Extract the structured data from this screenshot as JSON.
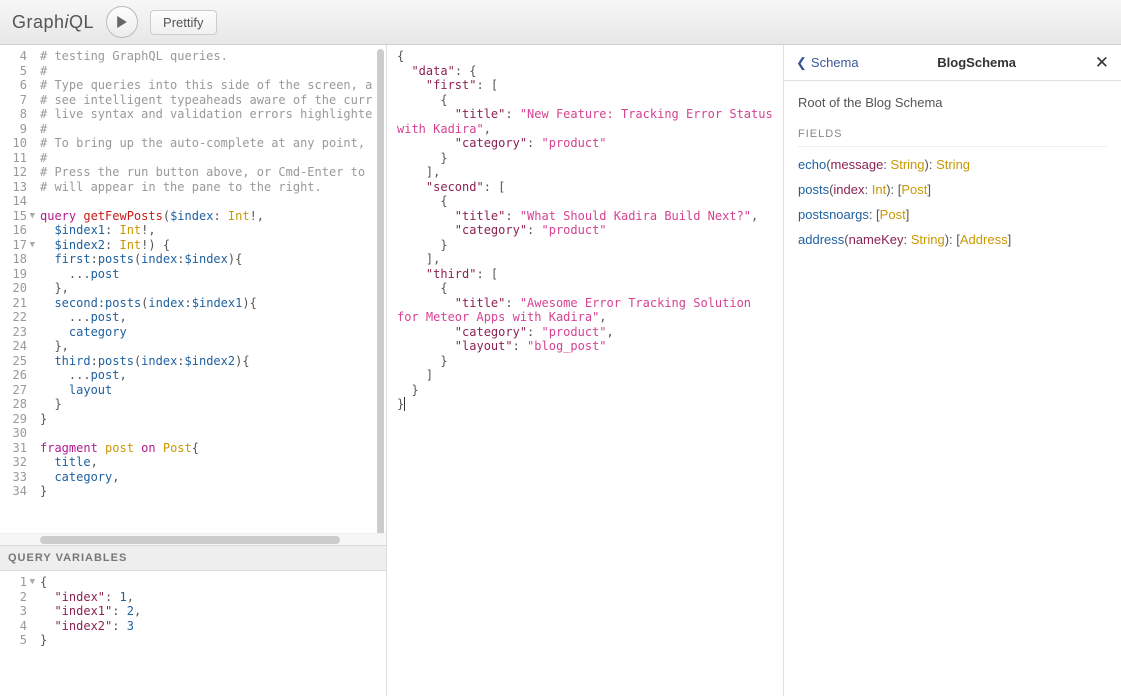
{
  "topbar": {
    "logo_pre": "Graph",
    "logo_i": "i",
    "logo_post": "QL",
    "prettify_label": "Prettify"
  },
  "query_lines": [
    {
      "n": 4,
      "html": "<span class='c-comment'># testing GraphQL queries.</span>"
    },
    {
      "n": 5,
      "html": "<span class='c-comment'>#</span>"
    },
    {
      "n": 6,
      "html": "<span class='c-comment'># Type queries into this side of the screen, a</span>"
    },
    {
      "n": 7,
      "html": "<span class='c-comment'># see intelligent typeaheads aware of the curr</span>"
    },
    {
      "n": 8,
      "html": "<span class='c-comment'># live syntax and validation errors highlighte</span>"
    },
    {
      "n": 9,
      "html": "<span class='c-comment'>#</span>"
    },
    {
      "n": 10,
      "html": "<span class='c-comment'># To bring up the auto-complete at any point,</span>"
    },
    {
      "n": 11,
      "html": "<span class='c-comment'>#</span>"
    },
    {
      "n": 12,
      "html": "<span class='c-comment'># Press the run button above, or Cmd-Enter to</span>"
    },
    {
      "n": 13,
      "html": "<span class='c-comment'># will appear in the pane to the right.</span>"
    },
    {
      "n": 14,
      "html": ""
    },
    {
      "n": 15,
      "fold": true,
      "html": "<span class='c-kw'>query</span> <span class='c-def'>getFewPosts</span>(<span class='c-var'>$index</span>: <span class='c-type'>Int</span>!,"
    },
    {
      "n": 16,
      "html": "  <span class='c-var'>$index1</span>: <span class='c-type'>Int</span>!,"
    },
    {
      "n": 17,
      "fold": true,
      "html": "  <span class='c-var'>$index2</span>: <span class='c-type'>Int</span>!) {"
    },
    {
      "n": 18,
      "html": "  <span class='c-prop'>first</span>:<span class='c-prop'>posts</span>(<span class='c-prop'>index</span>:<span class='c-var'>$index</span>){"
    },
    {
      "n": 19,
      "html": "    ...<span class='c-prop'>post</span>"
    },
    {
      "n": 20,
      "html": "  },"
    },
    {
      "n": 21,
      "html": "  <span class='c-prop'>second</span>:<span class='c-prop'>posts</span>(<span class='c-prop'>index</span>:<span class='c-var'>$index1</span>){"
    },
    {
      "n": 22,
      "html": "    ...<span class='c-prop'>post</span>,"
    },
    {
      "n": 23,
      "html": "    <span class='c-prop'>category</span>"
    },
    {
      "n": 24,
      "html": "  },"
    },
    {
      "n": 25,
      "html": "  <span class='c-prop'>third</span>:<span class='c-prop'>posts</span>(<span class='c-prop'>index</span>:<span class='c-var'>$index2</span>){"
    },
    {
      "n": 26,
      "html": "    ...<span class='c-prop'>post</span>,"
    },
    {
      "n": 27,
      "html": "    <span class='c-prop'>layout</span>"
    },
    {
      "n": 28,
      "html": "  }"
    },
    {
      "n": 29,
      "html": "}"
    },
    {
      "n": 30,
      "html": ""
    },
    {
      "n": 31,
      "html": "<span class='c-kw'>fragment</span> <span class='c-type'>post</span> <span class='c-kw'>on</span> <span class='c-type'>Post</span>{"
    },
    {
      "n": 32,
      "html": "  <span class='c-prop'>title</span>,"
    },
    {
      "n": 33,
      "html": "  <span class='c-prop'>category</span>,"
    },
    {
      "n": 34,
      "html": "}"
    }
  ],
  "vars_header": "QUERY VARIABLES",
  "vars_lines": [
    {
      "n": 1,
      "fold": true,
      "html": "{"
    },
    {
      "n": 2,
      "html": "  <span class='c-key'>\"index\"</span>: <span class='c-num'>1</span>,"
    },
    {
      "n": 3,
      "html": "  <span class='c-key'>\"index1\"</span>: <span class='c-num'>2</span>,"
    },
    {
      "n": 4,
      "html": "  <span class='c-key'>\"index2\"</span>: <span class='c-num'>3</span>"
    },
    {
      "n": 5,
      "html": "}"
    }
  ],
  "result_lines": [
    {
      "fold": true,
      "html": "{"
    },
    {
      "fold": true,
      "html": "  <span class='c-key'>\"data\"</span>: {"
    },
    {
      "fold": true,
      "html": "    <span class='c-key'>\"first\"</span>: ["
    },
    {
      "fold": true,
      "html": "      {"
    },
    {
      "html": "        <span class='c-key'>\"title\"</span>: <span class='c-str'>\"New Feature: Tracking Error Status with Kadira\"</span>,"
    },
    {
      "html": "        <span class='c-key'>\"category\"</span>: <span class='c-str'>\"product\"</span>"
    },
    {
      "html": "      }"
    },
    {
      "html": "    ],"
    },
    {
      "fold": true,
      "html": "    <span class='c-key'>\"second\"</span>: ["
    },
    {
      "fold": true,
      "html": "      {"
    },
    {
      "html": "        <span class='c-key'>\"title\"</span>: <span class='c-str'>\"What Should Kadira Build Next?\"</span>,"
    },
    {
      "html": "        <span class='c-key'>\"category\"</span>: <span class='c-str'>\"product\"</span>"
    },
    {
      "html": "      }"
    },
    {
      "html": "    ],"
    },
    {
      "fold": true,
      "html": "    <span class='c-key'>\"third\"</span>: ["
    },
    {
      "fold": true,
      "html": "      {"
    },
    {
      "html": "        <span class='c-key'>\"title\"</span>: <span class='c-str'>\"Awesome Error Tracking Solution for Meteor Apps with Kadira\"</span>,"
    },
    {
      "html": "        <span class='c-key'>\"category\"</span>: <span class='c-str'>\"product\"</span>,"
    },
    {
      "html": "        <span class='c-key'>\"layout\"</span>: <span class='c-str'>\"blog_post\"</span>"
    },
    {
      "html": "      }"
    },
    {
      "html": "    ]"
    },
    {
      "html": "  }"
    },
    {
      "html": "}<span style='border-left:1px solid #333'>&nbsp;</span>"
    }
  ],
  "docs": {
    "back_label": "Schema",
    "title": "BlogSchema",
    "description": "Root of the Blog Schema",
    "fields_header": "FIELDS",
    "fields": [
      {
        "name": "echo",
        "args": [
          {
            "name": "message",
            "type": "String"
          }
        ],
        "ret": "String"
      },
      {
        "name": "posts",
        "args": [
          {
            "name": "index",
            "type": "Int"
          }
        ],
        "ret": "[Post]"
      },
      {
        "name": "postsnoargs",
        "args": [],
        "ret": "[Post]"
      },
      {
        "name": "address",
        "args": [
          {
            "name": "nameKey",
            "type": "String"
          }
        ],
        "ret": "[Address]"
      }
    ]
  }
}
